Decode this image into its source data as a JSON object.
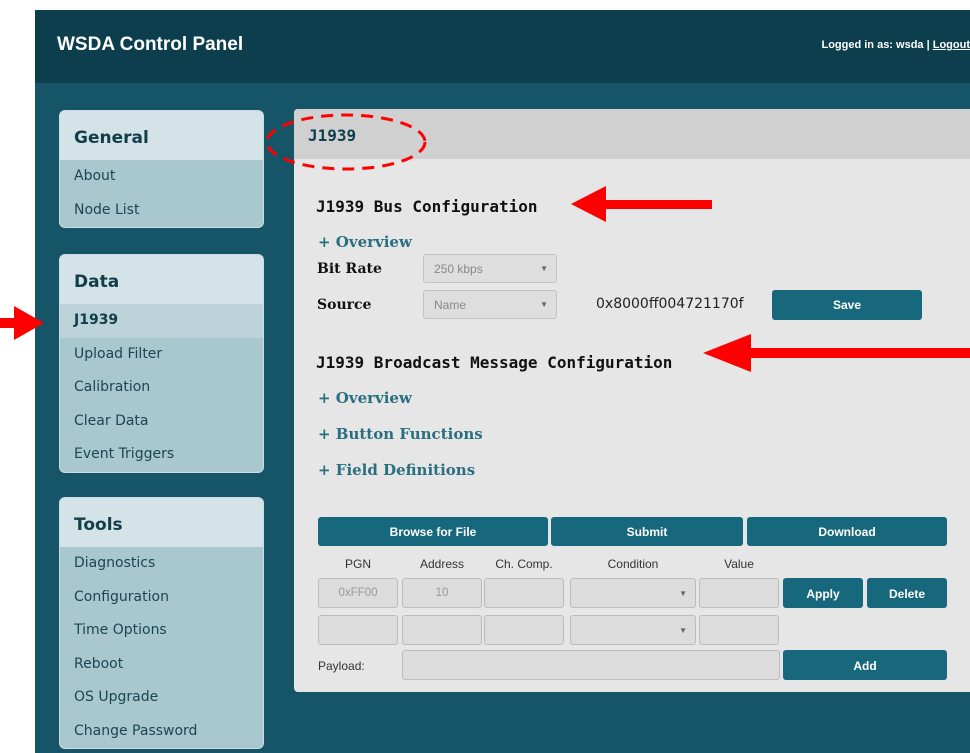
{
  "app": {
    "title": "WSDA Control Panel",
    "logged_in_text": "Logged in as: wsda |",
    "logout_label": "Logout"
  },
  "sidebar": {
    "general": {
      "title": "General",
      "items": [
        "About",
        "Node List"
      ]
    },
    "data": {
      "title": "Data",
      "items": [
        "J1939",
        "Upload Filter",
        "Calibration",
        "Clear Data",
        "Event Triggers"
      ],
      "active": "J1939"
    },
    "tools": {
      "title": "Tools",
      "items": [
        "Diagnostics",
        "Configuration",
        "Time Options",
        "Reboot",
        "OS Upgrade",
        "Change Password"
      ]
    }
  },
  "content": {
    "header": "J1939",
    "bus_config": {
      "title": "J1939 Bus Configuration",
      "overview_link": "+ Overview",
      "bit_rate_label": "Bit Rate",
      "bit_rate_value": "250 kbps",
      "source_label": "Source",
      "source_value": "Name",
      "source_hex": "0x8000ff004721170f",
      "save_label": "Save"
    },
    "broadcast_config": {
      "title": "J1939 Broadcast Message Configuration",
      "overview_link": "+ Overview",
      "button_functions_link": "+ Button Functions",
      "field_definitions_link": "+ Field Definitions"
    },
    "file_buttons": {
      "browse": "Browse for File",
      "submit": "Submit",
      "download": "Download"
    },
    "table": {
      "headers": [
        "PGN",
        "Address",
        "Ch. Comp.",
        "Condition",
        "Value"
      ],
      "row1": {
        "pgn": "0xFF00",
        "address": "10"
      },
      "apply_label": "Apply",
      "delete_label": "Delete",
      "payload_label": "Payload:",
      "add_label": "Add"
    }
  },
  "colors": {
    "frame_bg": "#155567",
    "topbar_bg": "#0d3e4d",
    "accent_button": "#17687d",
    "annotation_red": "#ff0000"
  }
}
